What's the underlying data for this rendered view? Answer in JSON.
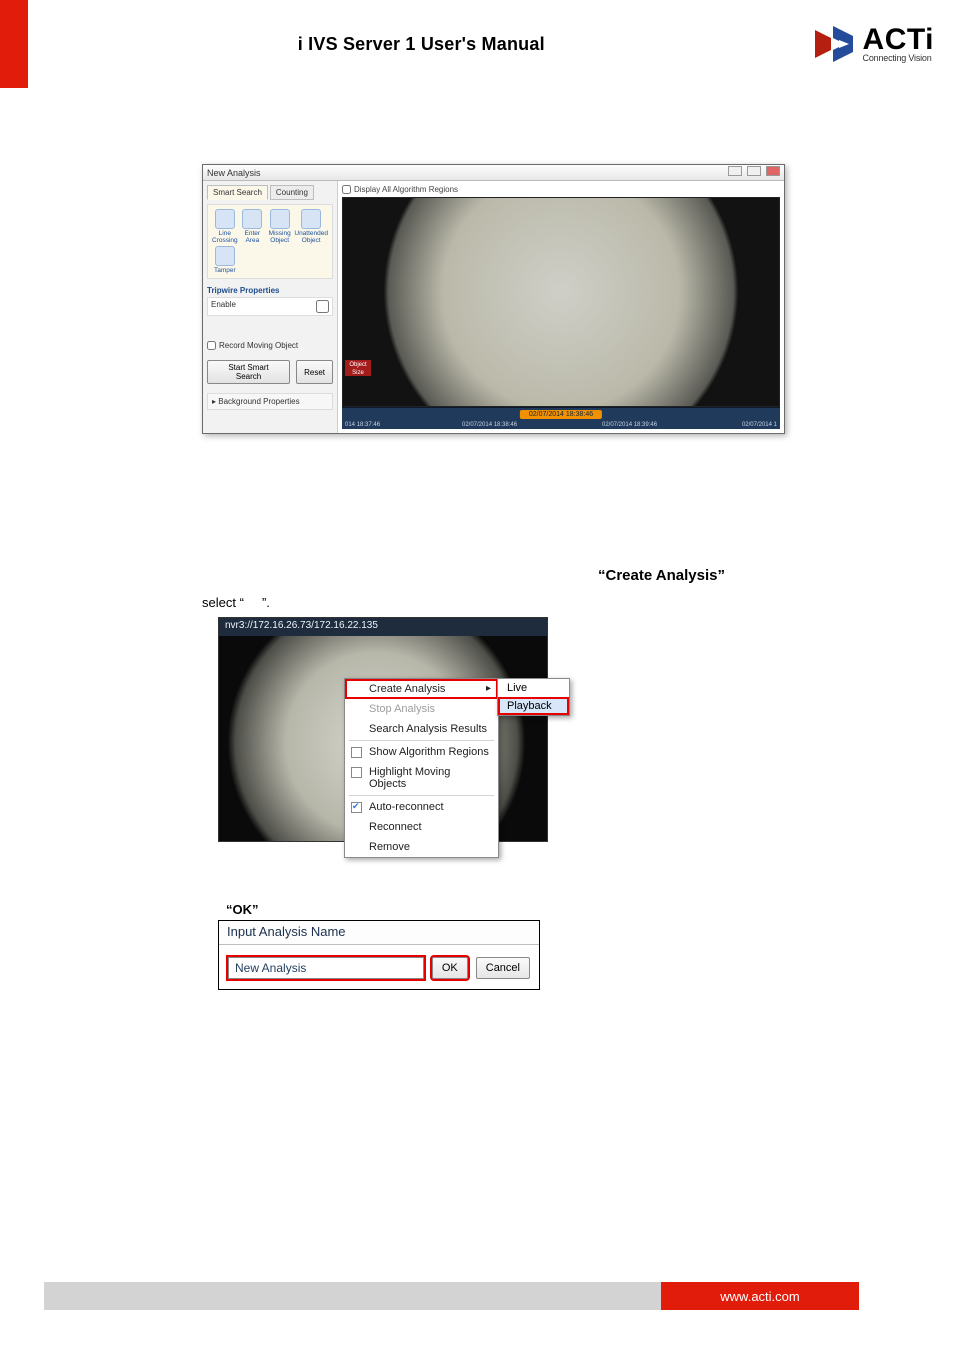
{
  "header": {
    "title": "i IVS Server 1 User's Manual",
    "logo_name": "ACTi",
    "logo_tag": "Connecting Vision"
  },
  "shot1": {
    "window_title": "New Analysis",
    "tabs": {
      "smart": "Smart Search",
      "counting": "Counting"
    },
    "tools": {
      "line": "Line Crossing",
      "enter": "Enter Area",
      "missing": "Missing Object",
      "unattended": "Unattended Object",
      "tamper": "Tamper"
    },
    "trip_heading": "Tripwire Properties",
    "prop_enable": "Enable",
    "record_moving": "Record Moving Object",
    "start_btn": "Start Smart Search",
    "reset_btn": "Reset",
    "bgprops": "Background Properties",
    "display_all": "Display All Algorithm Regions",
    "video_redlabel": "Object Size",
    "timeline_center": "02/07/2014 18:38:46",
    "ticks": {
      "t1": "014 18:37:46",
      "t2": "02/07/2014 18:38:46",
      "t3": "02/07/2014 18:39:46",
      "t4": "02/07/2014 1"
    }
  },
  "create_heading": "“Create Analysis”",
  "select_line_prefix": "select “",
  "select_line_suffix": "”.",
  "shot2": {
    "address": "nvr3://172.16.26.73/172.16.22.135",
    "menu": {
      "create": "Create Analysis",
      "stop": "Stop Analysis",
      "search": "Search Analysis Results",
      "showalg": "Show Algorithm Regions",
      "highlight": "Highlight Moving Objects",
      "auto": "Auto-reconnect",
      "reconnect": "Reconnect",
      "remove": "Remove"
    },
    "submenu": {
      "live": "Live",
      "playback": "Playback"
    }
  },
  "ok_heading": "“OK”",
  "shot3": {
    "title": "Input Analysis Name",
    "value": "New Analysis",
    "ok": "OK",
    "cancel": "Cancel"
  },
  "footer": {
    "url": "www.acti.com"
  }
}
